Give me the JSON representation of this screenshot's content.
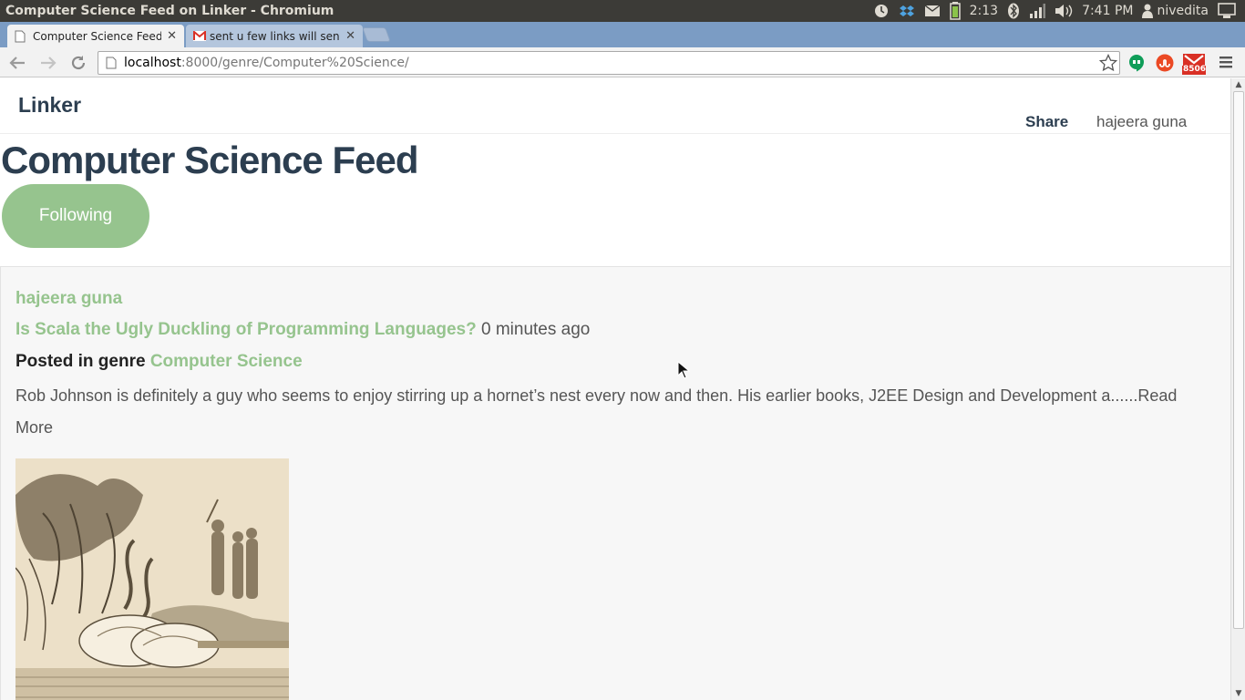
{
  "os": {
    "window_title": "Computer Science Feed on Linker - Chromium",
    "battery_time": "2:13",
    "clock": "7:41 PM",
    "user": "nivedita"
  },
  "browser": {
    "tabs": [
      {
        "title": "Computer Science Feed o",
        "active": true
      },
      {
        "title": "sent u few links will send",
        "active": false
      }
    ],
    "url_host": "localhost",
    "url_path": ":8000/genre/Computer%20Science/",
    "gmail_badge": "8506"
  },
  "site": {
    "brand": "Linker",
    "nav_share": "Share",
    "nav_user": "hajeera guna",
    "feed_title": "Computer Science Feed",
    "follow_label": "Following"
  },
  "post": {
    "author": "hajeera guna",
    "title": "Is Scala the Ugly Duckling of Programming Languages?",
    "time": "0 minutes ago",
    "genre_label": "Posted in genre",
    "genre": "Computer Science",
    "excerpt": "Rob Johnson is definitely a guy who seems to enjoy stirring up a hornet’s nest every now and then. His earlier books, J2EE Design and Development a......",
    "read_more": "Read More"
  },
  "colors": {
    "accent_green": "#96c48e",
    "heading": "#2c3e50"
  }
}
